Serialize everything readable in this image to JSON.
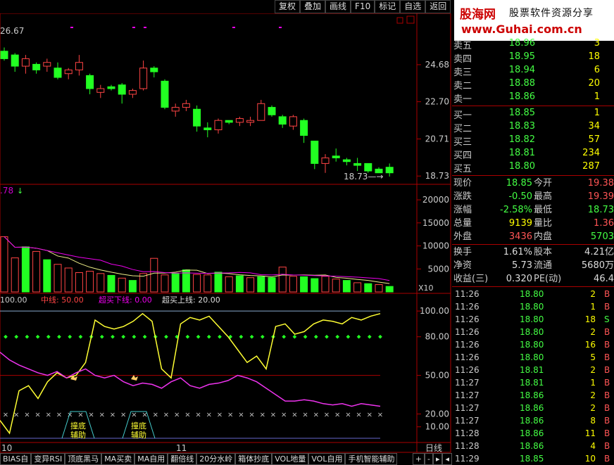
{
  "toolbar": [
    "复权",
    "叠加",
    "画线",
    "F10",
    "标记",
    "自选",
    "返回"
  ],
  "logo": {
    "brand": "股海网",
    "slogan": "股票软件资源分享",
    "url": "www.Guhai.com.cn"
  },
  "price_panel": {
    "top_left_label": "26.67",
    "axis_ticks": [
      "24.68",
      "22.70",
      "20.71",
      "18.73"
    ],
    "last_low_label": "18.73",
    "chart_data": {
      "type": "candlestick",
      "ohlc": [
        [
          25.4,
          25.6,
          24.9,
          25.0
        ],
        [
          25.2,
          25.3,
          24.3,
          24.6
        ],
        [
          24.6,
          25.2,
          24.2,
          25.0
        ],
        [
          24.7,
          24.8,
          24.2,
          24.4
        ],
        [
          24.6,
          25.0,
          24.3,
          24.8
        ],
        [
          24.5,
          24.8,
          23.9,
          24.0
        ],
        [
          24.2,
          24.5,
          23.9,
          24.4
        ],
        [
          24.4,
          25.2,
          24.1,
          24.8
        ],
        [
          24.1,
          24.2,
          23.1,
          23.4
        ],
        [
          23.2,
          23.6,
          22.9,
          23.4
        ],
        [
          23.5,
          23.6,
          23.3,
          23.4
        ],
        [
          23.6,
          23.7,
          22.6,
          23.1
        ],
        [
          23.1,
          23.4,
          22.9,
          23.3
        ],
        [
          23.4,
          24.9,
          23.3,
          24.5
        ],
        [
          24.5,
          24.6,
          24.0,
          24.3
        ],
        [
          23.8,
          23.9,
          22.3,
          22.4
        ],
        [
          22.2,
          22.6,
          21.9,
          22.4
        ],
        [
          22.4,
          22.8,
          22.2,
          22.6
        ],
        [
          22.3,
          22.5,
          21.1,
          21.4
        ],
        [
          21.3,
          21.6,
          20.8,
          21.2
        ],
        [
          21.2,
          21.8,
          21.0,
          21.7
        ],
        [
          21.7,
          21.7,
          21.5,
          21.6
        ],
        [
          21.6,
          21.9,
          21.4,
          21.8
        ],
        [
          21.6,
          21.9,
          21.4,
          21.7
        ],
        [
          21.7,
          22.8,
          21.7,
          22.6
        ],
        [
          22.4,
          22.5,
          21.9,
          22.0
        ],
        [
          21.9,
          22.0,
          21.3,
          21.5
        ],
        [
          21.4,
          22.0,
          21.2,
          21.9
        ],
        [
          21.7,
          21.8,
          20.5,
          20.9
        ],
        [
          20.6,
          20.6,
          19.1,
          19.4
        ],
        [
          19.4,
          19.9,
          18.9,
          19.7
        ],
        [
          19.8,
          20.2,
          19.5,
          19.7
        ],
        [
          19.6,
          19.7,
          19.3,
          19.5
        ],
        [
          19.4,
          19.7,
          19.0,
          19.3
        ],
        [
          19.4,
          19.4,
          18.9,
          19.0
        ],
        [
          19.1,
          19.2,
          18.9,
          18.9
        ],
        [
          19.2,
          19.4,
          18.7,
          18.9
        ]
      ],
      "ylim": [
        18.4,
        26.67
      ]
    }
  },
  "volume_panel": {
    "left_label": ".78",
    "axis_ticks": [
      "20000",
      "15000",
      "10000",
      "5000"
    ],
    "multiplier": "X10",
    "chart_data": {
      "type": "bar",
      "values": [
        12000,
        7400,
        9800,
        8800,
        7000,
        6000,
        5200,
        4200,
        4500,
        4000,
        3600,
        3000,
        2500,
        4000,
        7300,
        3700,
        4000,
        4800,
        3800,
        3700,
        4300,
        3300,
        3500,
        3100,
        3300,
        3100,
        5400,
        3400,
        3300,
        2900,
        3400,
        2800,
        2500,
        2000,
        1800,
        1600,
        1200
      ],
      "up": [
        true,
        true,
        false,
        true,
        false,
        true,
        true,
        true,
        true,
        true,
        false,
        true,
        false,
        true,
        true,
        true,
        false,
        false,
        true,
        true,
        false,
        true,
        false,
        true,
        false,
        false,
        true,
        true,
        false,
        false,
        true,
        true,
        false,
        true,
        false,
        true,
        false
      ],
      "ylim": [
        0,
        22000
      ]
    }
  },
  "indicator_panel": {
    "legend": [
      {
        "text": "100.00",
        "color": "#ccc"
      },
      {
        "text": "中线: 50.00",
        "color": "#f44"
      },
      {
        "text": "超买下线: 0.00",
        "color": "#e0e"
      },
      {
        "text": "超买上线: 20.00",
        "color": "#ddd"
      }
    ],
    "axis_ticks": [
      "100.00",
      "80.00",
      "50.00",
      "20.00",
      "10.00"
    ],
    "marker_label": "撞底辅助",
    "chart_data": {
      "type": "line",
      "series": [
        {
          "values": [
            15,
            5,
            38,
            42,
            32,
            45,
            52,
            48,
            50,
            60,
            93,
            88,
            86,
            88,
            92,
            98,
            92,
            55,
            48,
            90,
            95,
            93,
            96,
            88,
            80,
            70,
            60,
            65,
            55,
            88,
            90,
            82,
            84,
            90,
            93,
            92,
            90,
            95,
            93,
            96,
            98
          ],
          "color": "#ff3"
        },
        {
          "values": [
            68,
            62,
            58,
            55,
            52,
            50,
            53,
            48,
            52,
            55,
            50,
            48,
            50,
            45,
            42,
            44,
            43,
            40,
            45,
            48,
            42,
            40,
            43,
            44,
            46,
            50,
            48,
            45,
            40,
            35,
            30,
            30,
            31,
            30,
            28,
            27,
            28,
            26,
            28,
            27,
            26
          ],
          "color": "#e3e"
        }
      ],
      "ylim": [
        0,
        105
      ]
    }
  },
  "date_labels": [
    "10",
    "11"
  ],
  "period_label": "日线",
  "orderbook": {
    "asks": [
      {
        "label": "卖五",
        "price": "18.96",
        "vol": "3"
      },
      {
        "label": "卖四",
        "price": "18.95",
        "vol": "18"
      },
      {
        "label": "卖三",
        "price": "18.94",
        "vol": "6"
      },
      {
        "label": "卖二",
        "price": "18.88",
        "vol": "20"
      },
      {
        "label": "卖一",
        "price": "18.86",
        "vol": "1"
      }
    ],
    "bids": [
      {
        "label": "买一",
        "price": "18.85",
        "vol": "1"
      },
      {
        "label": "买二",
        "price": "18.83",
        "vol": "34"
      },
      {
        "label": "买三",
        "price": "18.82",
        "vol": "57"
      },
      {
        "label": "买四",
        "price": "18.81",
        "vol": "234"
      },
      {
        "label": "买五",
        "price": "18.80",
        "vol": "287"
      }
    ]
  },
  "stats": [
    [
      {
        "k": "现价",
        "v": "18.85",
        "c": "#4f4"
      },
      {
        "k": "今开",
        "v": "19.38",
        "c": "#f55"
      }
    ],
    [
      {
        "k": "涨跌",
        "v": "-0.50",
        "c": "#4f4"
      },
      {
        "k": "最高",
        "v": "19.39",
        "c": "#f55"
      }
    ],
    [
      {
        "k": "涨幅",
        "v": "-2.58%",
        "c": "#4f4"
      },
      {
        "k": "最低",
        "v": "18.73",
        "c": "#4f4"
      }
    ],
    [
      {
        "k": "总量",
        "v": "9139",
        "c": "#ff0"
      },
      {
        "k": "量比",
        "v": "1.36",
        "c": "#f55"
      }
    ],
    [
      {
        "k": "外盘",
        "v": "3436",
        "c": "#f55"
      },
      {
        "k": "内盘",
        "v": "5703",
        "c": "#4f4"
      }
    ]
  ],
  "stats2": [
    [
      {
        "k": "换手",
        "v": "1.61%",
        "c": "#ddd"
      },
      {
        "k": "股本",
        "v": "4.21亿",
        "c": "#ddd"
      }
    ],
    [
      {
        "k": "净资",
        "v": "5.73",
        "c": "#ddd"
      },
      {
        "k": "流通",
        "v": "5680万",
        "c": "#ddd"
      }
    ],
    [
      {
        "k": "收益(三)",
        "v": "0.320",
        "c": "#ddd"
      },
      {
        "k": "PE(动)",
        "v": "46.4",
        "c": "#ddd"
      }
    ]
  ],
  "ticks": [
    {
      "t": "11:26",
      "p": "18.80",
      "v": "2",
      "s": "B"
    },
    {
      "t": "11:26",
      "p": "18.80",
      "v": "1",
      "s": "B"
    },
    {
      "t": "11:26",
      "p": "18.80",
      "v": "18",
      "s": "S"
    },
    {
      "t": "11:26",
      "p": "18.80",
      "v": "2",
      "s": "B"
    },
    {
      "t": "11:26",
      "p": "18.80",
      "v": "16",
      "s": "B"
    },
    {
      "t": "11:26",
      "p": "18.80",
      "v": "5",
      "s": "B"
    },
    {
      "t": "11:26",
      "p": "18.81",
      "v": "2",
      "s": "B"
    },
    {
      "t": "11:27",
      "p": "18.81",
      "v": "1",
      "s": "B"
    },
    {
      "t": "11:27",
      "p": "18.86",
      "v": "2",
      "s": "B"
    },
    {
      "t": "11:27",
      "p": "18.86",
      "v": "2",
      "s": "B"
    },
    {
      "t": "11:27",
      "p": "18.86",
      "v": "8",
      "s": "B"
    },
    {
      "t": "11:28",
      "p": "18.86",
      "v": "11",
      "s": "B"
    },
    {
      "t": "11:28",
      "p": "18.86",
      "v": "4",
      "s": "B"
    },
    {
      "t": "11:29",
      "p": "18.85",
      "v": "10",
      "s": "B"
    }
  ],
  "tabs": [
    "BIAS自",
    "变异RSI",
    "顶底黑马",
    "MA买卖",
    "MA自用",
    "翻倍线",
    "20分水岭",
    "箱体抄底",
    "VOL地量",
    "VOL自用",
    "手机智能辅助"
  ],
  "tab_controls": [
    "+",
    "-",
    "▸",
    "◂"
  ]
}
